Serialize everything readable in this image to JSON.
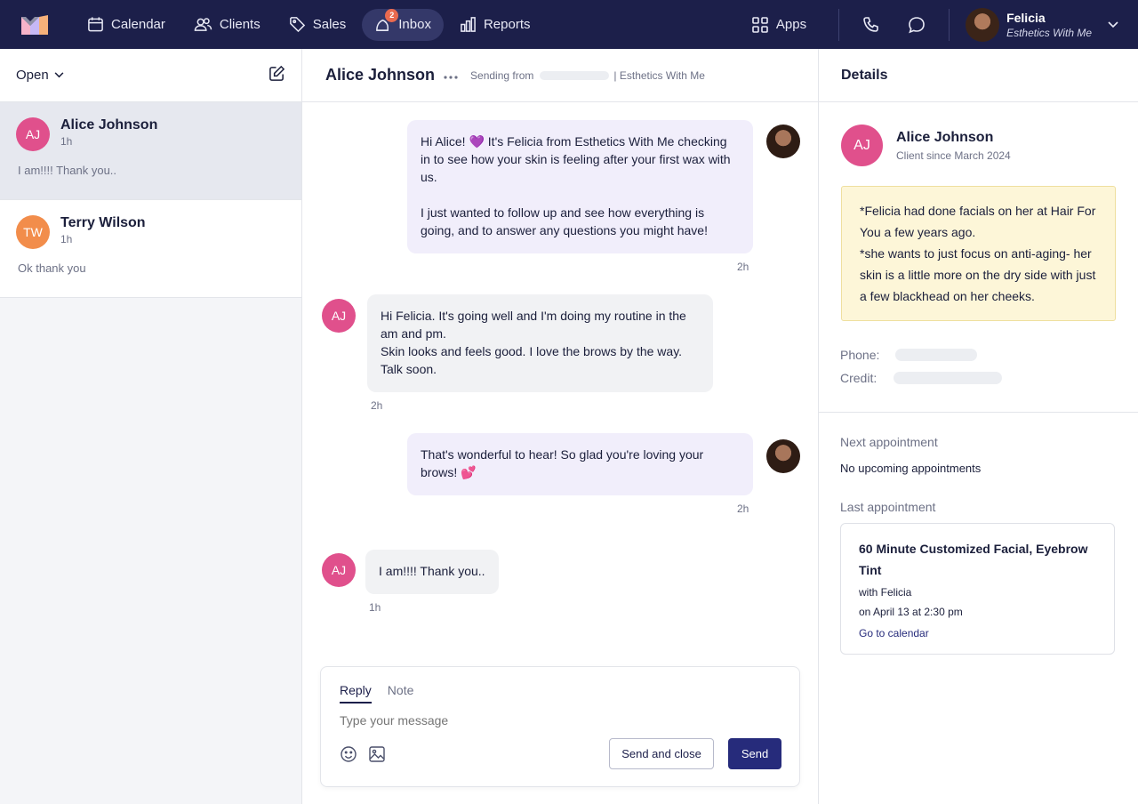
{
  "nav": {
    "items": [
      {
        "label": "Calendar",
        "icon": "calendar-icon"
      },
      {
        "label": "Clients",
        "icon": "users-icon"
      },
      {
        "label": "Sales",
        "icon": "tag-icon"
      },
      {
        "label": "Inbox",
        "icon": "inbox-icon",
        "badge": "2"
      },
      {
        "label": "Reports",
        "icon": "bar-chart-icon"
      }
    ],
    "apps_label": "Apps",
    "user": {
      "name": "Felicia",
      "business": "Esthetics With Me"
    }
  },
  "sidebar": {
    "filter_label": "Open",
    "conversations": [
      {
        "initials": "AJ",
        "name": "Alice Johnson",
        "time": "1h",
        "preview": "I am!!!! Thank you.."
      },
      {
        "initials": "TW",
        "name": "Terry Wilson",
        "time": "1h",
        "preview": "Ok thank you"
      }
    ]
  },
  "chat": {
    "title": "Alice Johnson",
    "sending_from_label": "Sending from",
    "sending_from_business": "| Esthetics With Me",
    "messages": [
      {
        "direction": "out",
        "text_p1": "Hi Alice! 💜  It's Felicia from Esthetics With Me checking in to see how your skin is feeling after your first wax with us.",
        "text_p2": "I just wanted to follow up and see how everything is going, and to answer any questions you might have!",
        "time": "2h"
      },
      {
        "direction": "in",
        "initials": "AJ",
        "text_p1": "Hi Felicia.  It's going well and I'm doing my routine in the am and pm.",
        "text_p2": "Skin looks and feels good.  I love the brows by the way.  Talk soon.",
        "time": "2h"
      },
      {
        "direction": "out",
        "text_p1": "That's wonderful to hear! So glad you're loving your brows! 💕",
        "time": "2h"
      },
      {
        "direction": "in",
        "initials": "AJ",
        "text_p1": "I am!!!!  Thank you..",
        "time": "1h"
      }
    ],
    "composer": {
      "tabs": [
        "Reply",
        "Note"
      ],
      "placeholder": "Type your message",
      "send_close_label": "Send and close",
      "send_label": "Send"
    }
  },
  "details": {
    "title": "Details",
    "client": {
      "initials": "AJ",
      "name": "Alice Johnson",
      "since": "Client since March 2024"
    },
    "note_lines": [
      "*Felicia had done facials on her at Hair For You a few years ago.",
      "*she wants to just focus on anti-aging- her skin is a little more on the dry side with just a few blackhead on her cheeks."
    ],
    "phone_label": "Phone:",
    "credit_label": "Credit:",
    "next_appt_label": "Next appointment",
    "next_appt_value": "No upcoming appointments",
    "last_appt_label": "Last appointment",
    "last_appt": {
      "title": "60 Minute Customized Facial, Eyebrow Tint",
      "with": "with Felicia",
      "when": "on April 13 at 2:30 pm",
      "link": "Go to calendar"
    }
  },
  "colors": {
    "nav_bg": "#1c1f4a",
    "accent": "#262b7b",
    "avatar_aj": "#e0508c",
    "avatar_tw": "#f28d4b",
    "note_bg": "#fdf6d8",
    "outgoing_bubble": "#f1eefb"
  }
}
